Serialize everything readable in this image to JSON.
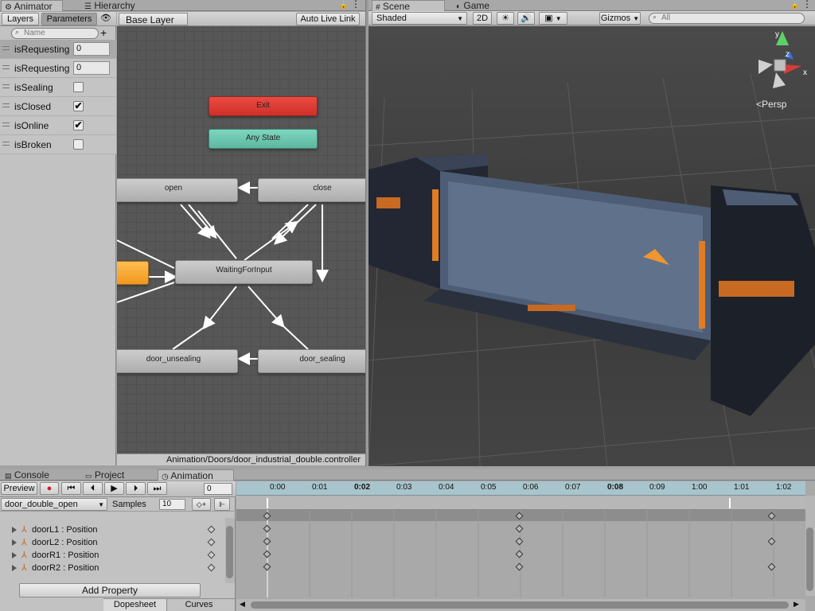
{
  "animator": {
    "tabs": [
      {
        "label": "Animator"
      },
      {
        "label": "Hierarchy"
      }
    ],
    "subtabs": {
      "layers": "Layers",
      "parameters": "Parameters"
    },
    "search_placeholder": "Name",
    "layer_name": "Base Layer",
    "auto_live_link": "Auto Live Link",
    "parameters": [
      {
        "name": "isRequestingOpen",
        "type": "int",
        "value": "0"
      },
      {
        "name": "isRequestingClose",
        "type": "int",
        "value": "0"
      },
      {
        "name": "isSealing",
        "type": "bool",
        "checked": false
      },
      {
        "name": "isClosed",
        "type": "bool",
        "checked": true,
        "mark": "✔"
      },
      {
        "name": "isOnline",
        "type": "bool",
        "checked": true,
        "mark": "✔"
      },
      {
        "name": "isBroken",
        "type": "bool",
        "checked": false
      }
    ],
    "states": {
      "exit": "Exit",
      "any_state": "Any State",
      "open": "open",
      "close": "close",
      "waiting": "WaitingForInput",
      "door_unsealing": "door_unsealing",
      "door_sealing": "door_sealing"
    },
    "controller_path": "Animation/Doors/door_industrial_double.controller",
    "colors": {
      "exit": "#e03a32",
      "any_state": "#6dc5ae",
      "entry": "#f3a12b"
    }
  },
  "scene": {
    "tabs": [
      {
        "label": "Scene"
      },
      {
        "label": "Game"
      }
    ],
    "shading": "Shaded",
    "mode_2d": "2D",
    "gizmos": "Gizmos",
    "search_placeholder": "All",
    "persp_label": "Persp",
    "axis": {
      "x": "x",
      "y": "y",
      "z": "z"
    }
  },
  "bottom": {
    "tabs": [
      {
        "label": "Console"
      },
      {
        "label": "Project"
      },
      {
        "label": "Animation"
      }
    ],
    "preview": "Preview",
    "frame": "0",
    "clip": "door_double_open",
    "samples_label": "Samples",
    "samples": "10",
    "timecodes": [
      "0:00",
      "0:01",
      "0:02",
      "0:03",
      "0:04",
      "0:05",
      "0:06",
      "0:07",
      "0:08",
      "0:09",
      "1:00",
      "1:01",
      "1:02"
    ],
    "tracks": [
      {
        "name": "doorL1 : Position"
      },
      {
        "name": "doorL2 : Position"
      },
      {
        "name": "doorR1 : Position"
      },
      {
        "name": "doorR2 : Position"
      }
    ],
    "add_property": "Add Property",
    "view_tabs": {
      "dopesheet": "Dopesheet",
      "curves": "Curves"
    }
  }
}
